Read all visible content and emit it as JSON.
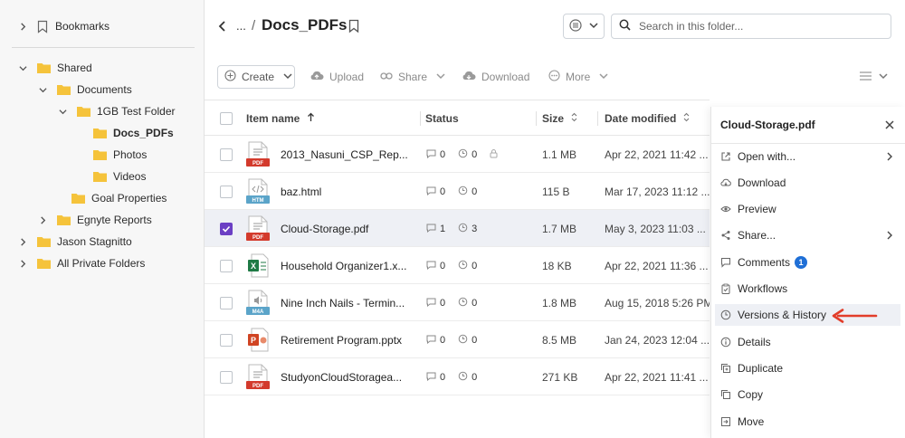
{
  "sidebar": {
    "bookmarks_label": "Bookmarks",
    "tree": [
      {
        "label": "Shared",
        "level": 0,
        "expanded": true
      },
      {
        "label": "Documents",
        "level": 1,
        "expanded": true
      },
      {
        "label": "1GB Test Folder",
        "level": 2,
        "expanded": true
      },
      {
        "label": "Docs_PDFs",
        "level": 3,
        "active": true
      },
      {
        "label": "Photos",
        "level": 3
      },
      {
        "label": "Videos",
        "level": 3
      },
      {
        "label": "Goal Properties",
        "level": 2
      },
      {
        "label": "Egnyte Reports",
        "level": 1,
        "expanded": false
      },
      {
        "label": "Jason Stagnitto",
        "level": 0,
        "expanded": false
      },
      {
        "label": "All Private Folders",
        "level": 0,
        "expanded": false
      }
    ]
  },
  "header": {
    "breadcrumb_ellipsis": "...",
    "breadcrumb_sep": "/",
    "title": "Docs_PDFs",
    "search_placeholder": "Search in this folder..."
  },
  "toolbar": {
    "create": "Create",
    "upload": "Upload",
    "share": "Share",
    "download": "Download",
    "more": "More"
  },
  "table": {
    "columns": {
      "name": "Item name",
      "status": "Status",
      "size": "Size",
      "modified": "Date modified"
    },
    "rows": [
      {
        "name": "2013_Nasuni_CSP_Rep...",
        "type": "PDF",
        "comments": "0",
        "versions": "0",
        "locked": true,
        "size": "1.1 MB",
        "modified": "Apr 22, 2021 11:42 ...",
        "selected": false
      },
      {
        "name": "baz.html",
        "type": "HTM",
        "comments": "0",
        "versions": "0",
        "size": "115 B",
        "modified": "Mar 17, 2023 11:12 ...",
        "selected": false
      },
      {
        "name": "Cloud-Storage.pdf",
        "type": "PDF",
        "comments": "1",
        "versions": "3",
        "size": "1.7 MB",
        "modified": "May 3, 2023 11:03 ...",
        "selected": true
      },
      {
        "name": "Household Organizer1.x...",
        "type": "XLS",
        "comments": "0",
        "versions": "0",
        "size": "18 KB",
        "modified": "Apr 22, 2021 11:36 ...",
        "selected": false
      },
      {
        "name": "Nine Inch Nails - Termin...",
        "type": "M4A",
        "comments": "0",
        "versions": "0",
        "size": "1.8 MB",
        "modified": "Aug 15, 2018 5:26 PM",
        "selected": false
      },
      {
        "name": "Retirement Program.pptx",
        "type": "PPT",
        "comments": "0",
        "versions": "0",
        "size": "8.5 MB",
        "modified": "Jan 24, 2023 12:04 ...",
        "selected": false
      },
      {
        "name": "StudyonCloudStoragea...",
        "type": "PDF",
        "comments": "0",
        "versions": "0",
        "size": "271 KB",
        "modified": "Apr 22, 2021 11:41 ...",
        "selected": false
      }
    ]
  },
  "context_menu": {
    "title": "Cloud-Storage.pdf",
    "items": [
      {
        "label": "Open with...",
        "icon": "open-external-icon",
        "submenu": true
      },
      {
        "label": "Download",
        "icon": "cloud-download-icon"
      },
      {
        "label": "Preview",
        "icon": "eye-icon"
      },
      {
        "label": "Share...",
        "icon": "share-icon",
        "submenu": true
      },
      {
        "label": "Comments",
        "icon": "comment-icon",
        "badge": "1"
      },
      {
        "label": "Workflows",
        "icon": "clipboard-check-icon"
      },
      {
        "label": "Versions & History",
        "icon": "clock-icon",
        "highlighted": true
      },
      {
        "label": "Details",
        "icon": "info-icon"
      },
      {
        "label": "Duplicate",
        "icon": "duplicate-icon"
      },
      {
        "label": "Copy",
        "icon": "copy-icon"
      },
      {
        "label": "Move",
        "icon": "move-icon"
      }
    ]
  },
  "colors": {
    "accent": "#6b3fc4",
    "folder": "#f5c33b",
    "pdf": "#d33a2c",
    "html": "#5ba4c9",
    "excel": "#1f7a45",
    "annotation": "#e23d2a",
    "badge": "#1f6fd6"
  }
}
